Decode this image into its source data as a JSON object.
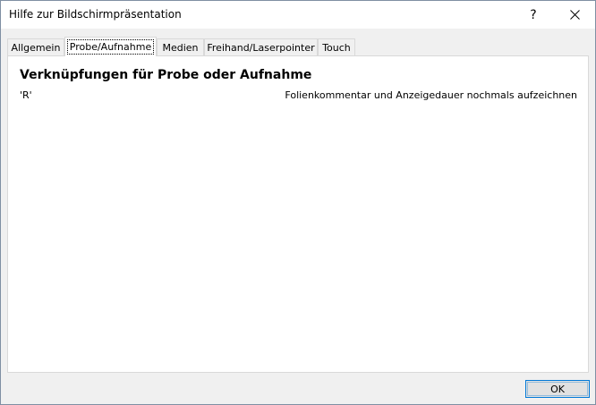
{
  "window": {
    "title": "Hilfe zur Bildschirmpräsentation",
    "help_button": "?",
    "close_icon": "close-icon"
  },
  "tabs": [
    {
      "label": "Allgemein",
      "active": false
    },
    {
      "label": "Probe/Aufnahme",
      "active": true
    },
    {
      "label": "Medien",
      "active": false
    },
    {
      "label": "Freihand/Laserpointer",
      "active": false
    },
    {
      "label": "Touch",
      "active": false
    }
  ],
  "panel": {
    "heading": "Verknüpfungen für Probe oder Aufnahme",
    "shortcuts": [
      {
        "key": "'R'",
        "description": "Folienkommentar und Anzeigedauer nochmals aufzeichnen"
      }
    ]
  },
  "footer": {
    "ok_label": "OK"
  },
  "colors": {
    "accent": "#0078d7",
    "dialog_bg": "#f0f0f0",
    "panel_bg": "#ffffff"
  }
}
